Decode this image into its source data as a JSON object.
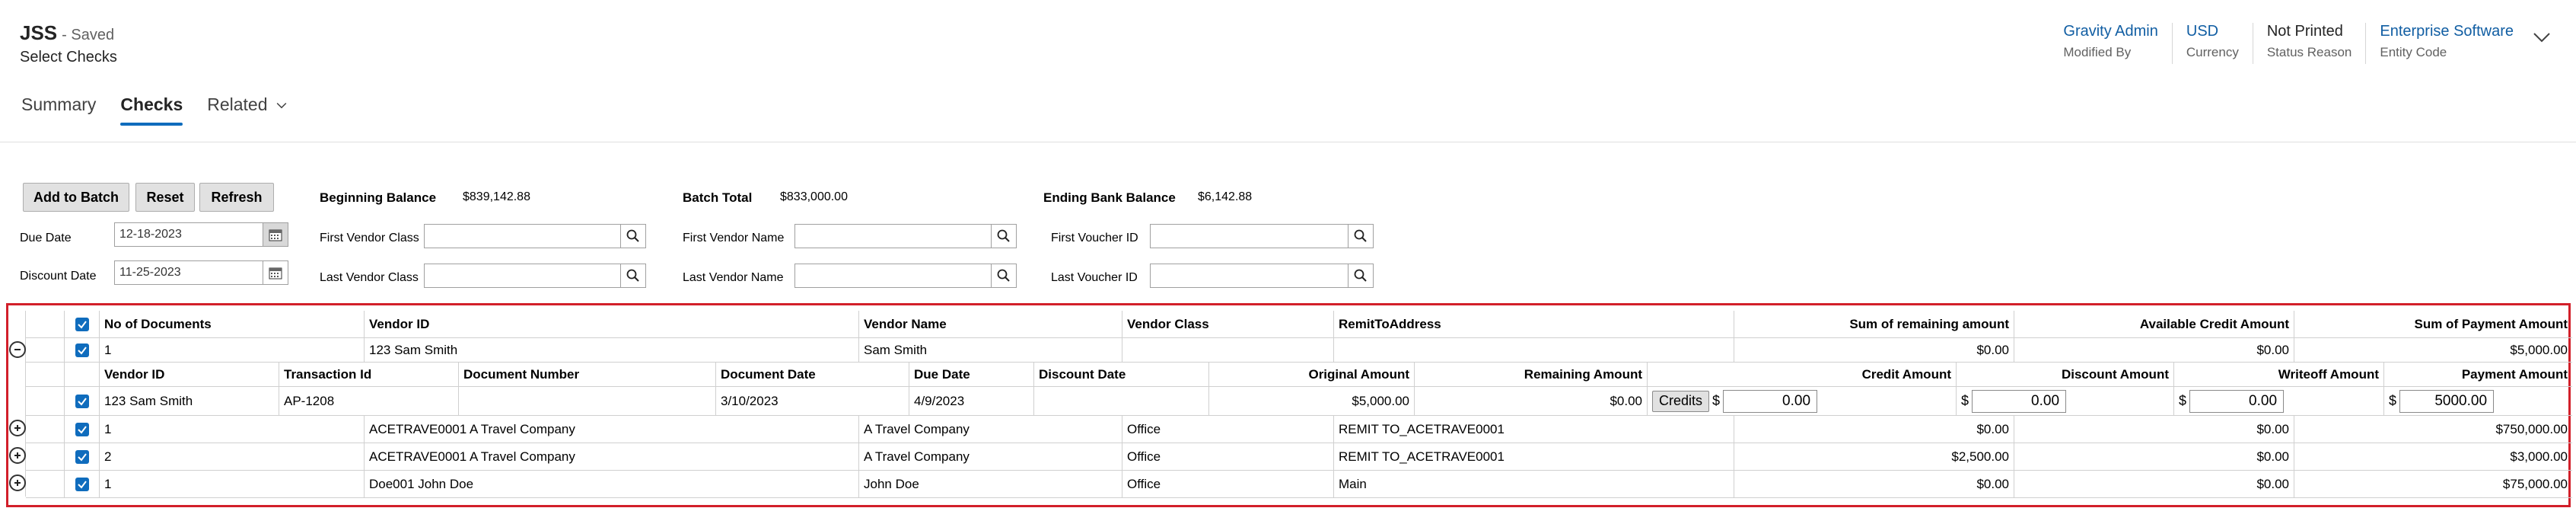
{
  "header": {
    "record_name": "JSS",
    "saved_status": "- Saved",
    "form_name": "Select Checks",
    "fields": [
      {
        "value": "Gravity Admin",
        "label": "Modified By",
        "link": true
      },
      {
        "value": "USD",
        "label": "Currency",
        "link": true
      },
      {
        "value": "Not Printed",
        "label": "Status Reason",
        "link": false
      },
      {
        "value": "Enterprise Software",
        "label": "Entity Code",
        "link": true
      }
    ],
    "expand_icon": "chevron-down-icon"
  },
  "tabs": [
    {
      "label": "Summary",
      "active": false
    },
    {
      "label": "Checks",
      "active": true
    },
    {
      "label": "Related",
      "active": false,
      "has_menu": true
    }
  ],
  "toolbar": {
    "add_to_batch": "Add to Batch",
    "reset": "Reset",
    "refresh": "Refresh"
  },
  "balances": {
    "beginning_label": "Beginning Balance",
    "beginning_value": "$839,142.88",
    "batch_label": "Batch Total",
    "batch_value": "$833,000.00",
    "ending_label": "Ending Bank Balance",
    "ending_value": "$6,142.88"
  },
  "filters": {
    "due_date_label": "Due Date",
    "due_date_value": "12-18-2023",
    "discount_date_label": "Discount Date",
    "discount_date_value": "11-25-2023",
    "first_vendor_class": "First Vendor Class",
    "last_vendor_class": "Last Vendor Class",
    "first_vendor_name": "First Vendor Name",
    "last_vendor_name": "Last Vendor Name",
    "first_voucher_id": "First Voucher ID",
    "last_voucher_id": "Last Voucher ID"
  },
  "grid": {
    "columns": [
      "No of Documents",
      "Vendor ID",
      "Vendor Name",
      "Vendor Class",
      "RemitToAddress",
      "Sum of remaining amount",
      "Available Credit Amount",
      "Sum of Payment Amount"
    ],
    "rows": [
      {
        "docs": "1",
        "vendor_id": "123 Sam Smith",
        "vendor_name": "Sam Smith",
        "vendor_class": "",
        "remit": "",
        "remaining": "$0.00",
        "credit": "$0.00",
        "payment": "$5,000.00",
        "expanded": true
      },
      {
        "docs": "1",
        "vendor_id": "ACETRAVE0001 A Travel Company",
        "vendor_name": "A Travel Company",
        "vendor_class": "Office",
        "remit": "REMIT TO_ACETRAVE0001",
        "remaining": "$0.00",
        "credit": "$0.00",
        "payment": "$750,000.00",
        "expanded": false
      },
      {
        "docs": "2",
        "vendor_id": "ACETRAVE0001 A Travel Company",
        "vendor_name": "A Travel Company",
        "vendor_class": "Office",
        "remit": "REMIT TO_ACETRAVE0001",
        "remaining": "$2,500.00",
        "credit": "$0.00",
        "payment": "$3,000.00",
        "expanded": false
      },
      {
        "docs": "1",
        "vendor_id": "Doe001 John Doe",
        "vendor_name": "John Doe",
        "vendor_class": "Office",
        "remit": "Main",
        "remaining": "$0.00",
        "credit": "$0.00",
        "payment": "$75,000.00",
        "expanded": false
      }
    ],
    "sub_columns": [
      "Vendor ID",
      "Transaction Id",
      "Document Number",
      "Document Date",
      "Due Date",
      "Discount Date",
      "Original Amount",
      "Remaining Amount",
      "Credit Amount",
      "Discount Amount",
      "Writeoff Amount",
      "Payment Amount"
    ],
    "sub_row": {
      "vendor_id": "123 Sam Smith",
      "transaction_id": "AP-1208",
      "document_number": "",
      "document_date": "3/10/2023",
      "due_date": "4/9/2023",
      "discount_date": "",
      "original_amount": "$5,000.00",
      "remaining_amount": "$0.00",
      "credits_button": "Credits",
      "currency_symbol": "$",
      "credit_amount": "0.00",
      "discount_amount": "0.00",
      "writeoff_amount": "0.00",
      "payment_amount": "5000.00"
    }
  },
  "colors": {
    "accent": "#0f6cbd",
    "link": "#115ea3",
    "highlight_border": "#d21f2a"
  }
}
